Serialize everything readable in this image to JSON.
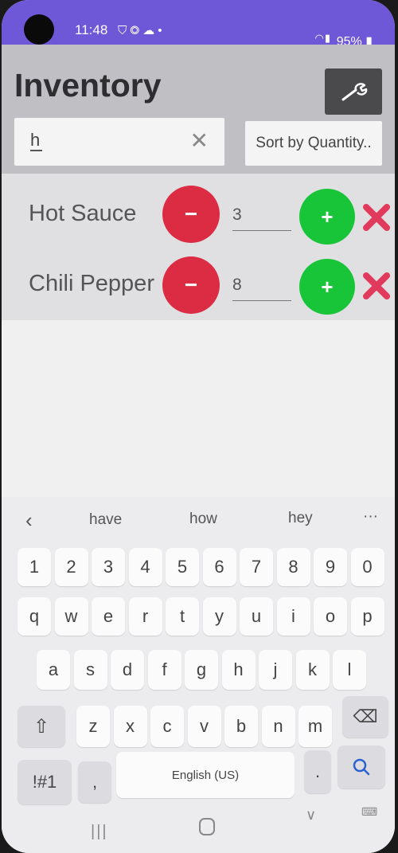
{
  "status_bar": {
    "time": "11:48",
    "notification_icons": [
      "shield-icon",
      "chat-icon",
      "cloud-icon",
      "dot-icon"
    ],
    "battery": "95%",
    "signal_icons": [
      "wifi-icon",
      "signal-icon"
    ]
  },
  "app": {
    "title": "Inventory",
    "settings_icon": "wrench-icon",
    "search": {
      "value": "h"
    },
    "sort_button_label": "Sort by Quantity..",
    "colors": {
      "header": "#c0c0c4",
      "minus": "#dc2c44",
      "plus": "#18c438",
      "delete": "#e23a5c",
      "accent": "#6f58d8"
    }
  },
  "items": [
    {
      "name": "Hot Sauce",
      "quantity": "3",
      "minus_label": "−",
      "plus_label": "+"
    },
    {
      "name": "Chili Pepper",
      "quantity": "8",
      "minus_label": "−",
      "plus_label": "+"
    }
  ],
  "keyboard": {
    "suggestions": [
      "have",
      "how",
      "hey"
    ],
    "more_label": "···",
    "numbers": [
      "1",
      "2",
      "3",
      "4",
      "5",
      "6",
      "7",
      "8",
      "9",
      "0"
    ],
    "row1": [
      "q",
      "w",
      "e",
      "r",
      "t",
      "y",
      "u",
      "i",
      "o",
      "p"
    ],
    "row2": [
      "a",
      "s",
      "d",
      "f",
      "g",
      "h",
      "j",
      "k",
      "l"
    ],
    "row3": [
      "z",
      "x",
      "c",
      "v",
      "b",
      "n",
      "m"
    ],
    "symbols_label": "!#1",
    "comma_label": ",",
    "space_label": "English (US)",
    "period_label": "."
  }
}
